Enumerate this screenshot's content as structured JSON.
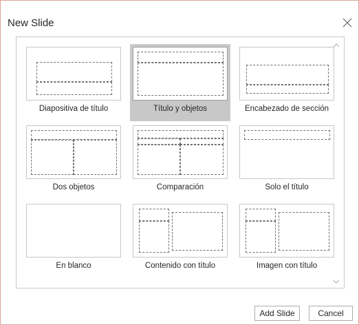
{
  "dialog": {
    "title": "New Slide",
    "close_icon": "close-icon"
  },
  "layouts": [
    {
      "label": "Diapositiva de título",
      "selected": false
    },
    {
      "label": "Título y objetos",
      "selected": true
    },
    {
      "label": "Encabezado de sección",
      "selected": false
    },
    {
      "label": "Dos objetos",
      "selected": false
    },
    {
      "label": "Comparación",
      "selected": false
    },
    {
      "label": "Solo el título",
      "selected": false
    },
    {
      "label": "En blanco",
      "selected": false
    },
    {
      "label": "Contenido con título",
      "selected": false
    },
    {
      "label": "Imagen con título",
      "selected": false
    }
  ],
  "buttons": {
    "add": "Add Slide",
    "cancel": "Cancel"
  },
  "colors": {
    "dialog_border": "#d9a696",
    "selection": "#c8c8c8"
  }
}
